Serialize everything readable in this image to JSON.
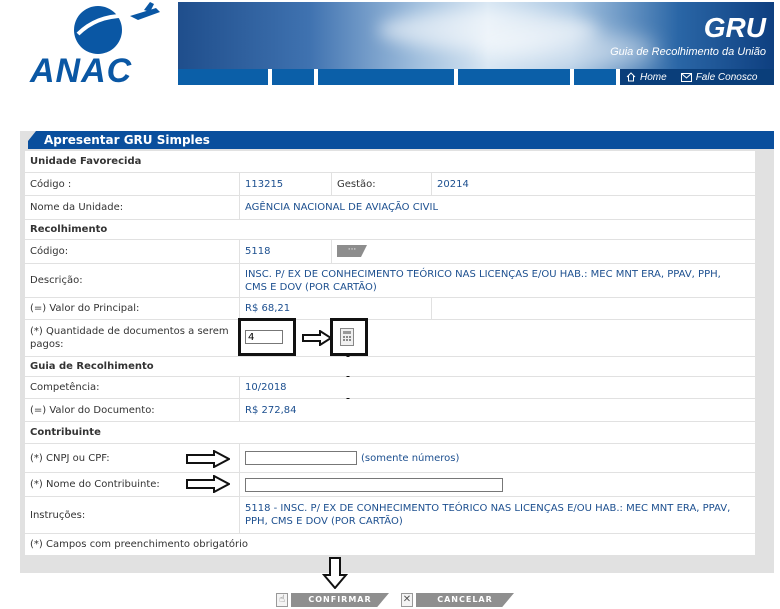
{
  "header": {
    "logo_text": "ANAC",
    "banner_title": "GRU",
    "banner_subtitle": "Guia de Recolhimento da União",
    "nav_home": "Home",
    "nav_contact": "Fale Conosco"
  },
  "panel": {
    "title": "Apresentar GRU Simples",
    "unidade": {
      "section": "Unidade Favorecida",
      "codigo_label": "Código :",
      "codigo_value": "113215",
      "gestao_label": "Gestão:",
      "gestao_value": "20214",
      "nome_label": "Nome da Unidade:",
      "nome_value": "AGÊNCIA NACIONAL DE AVIAÇÃO CIVIL"
    },
    "recolhimento": {
      "section": "Recolhimento",
      "codigo_label": "Código:",
      "codigo_value": "5118",
      "lookup_label": "···",
      "descricao_label": "Descrição:",
      "descricao_value": "INSC. P/ EX DE CONHECIMENTO TEÓRICO NAS LICENÇAS E/OU HAB.: MEC MNT ERA, PPAV, PPH, CMS E DOV (POR CARTÃO)",
      "principal_label": "(=) Valor do Principal:",
      "principal_value": "R$ 68,21",
      "quantidade_label": "(*) Quantidade de documentos a serem pagos:",
      "quantidade_value": "4"
    },
    "guia": {
      "section": "Guia de Recolhimento",
      "competencia_label": "Competência:",
      "competencia_value": "10/2018",
      "documento_label": "(=) Valor do Documento:",
      "documento_value": "R$ 272,84"
    },
    "contribuinte": {
      "section": "Contribuinte",
      "cnpj_label": "(*) CNPJ ou CPF:",
      "cnpj_value": "",
      "cnpj_hint": "(somente números)",
      "nome_label": "(*) Nome do Contribuinte:",
      "nome_value": "",
      "instrucoes_label": "Instruções:",
      "instrucoes_value": "5118  -  INSC. P/ EX DE CONHECIMENTO TEÓRICO NAS LICENÇAS E/OU HAB.: MEC MNT ERA, PPAV, PPH, CMS E DOV (POR CARTÃO)",
      "obrigatorio_note": "(*) Campos com preenchimento obrigatório"
    }
  },
  "actions": {
    "confirm_label": "CONFIRMAR",
    "cancel_label": "CANCELAR"
  },
  "colors": {
    "brand_blue": "#0a4f9d",
    "value_text": "#1c4f8f",
    "panel_gray": "#e1e1e1"
  }
}
